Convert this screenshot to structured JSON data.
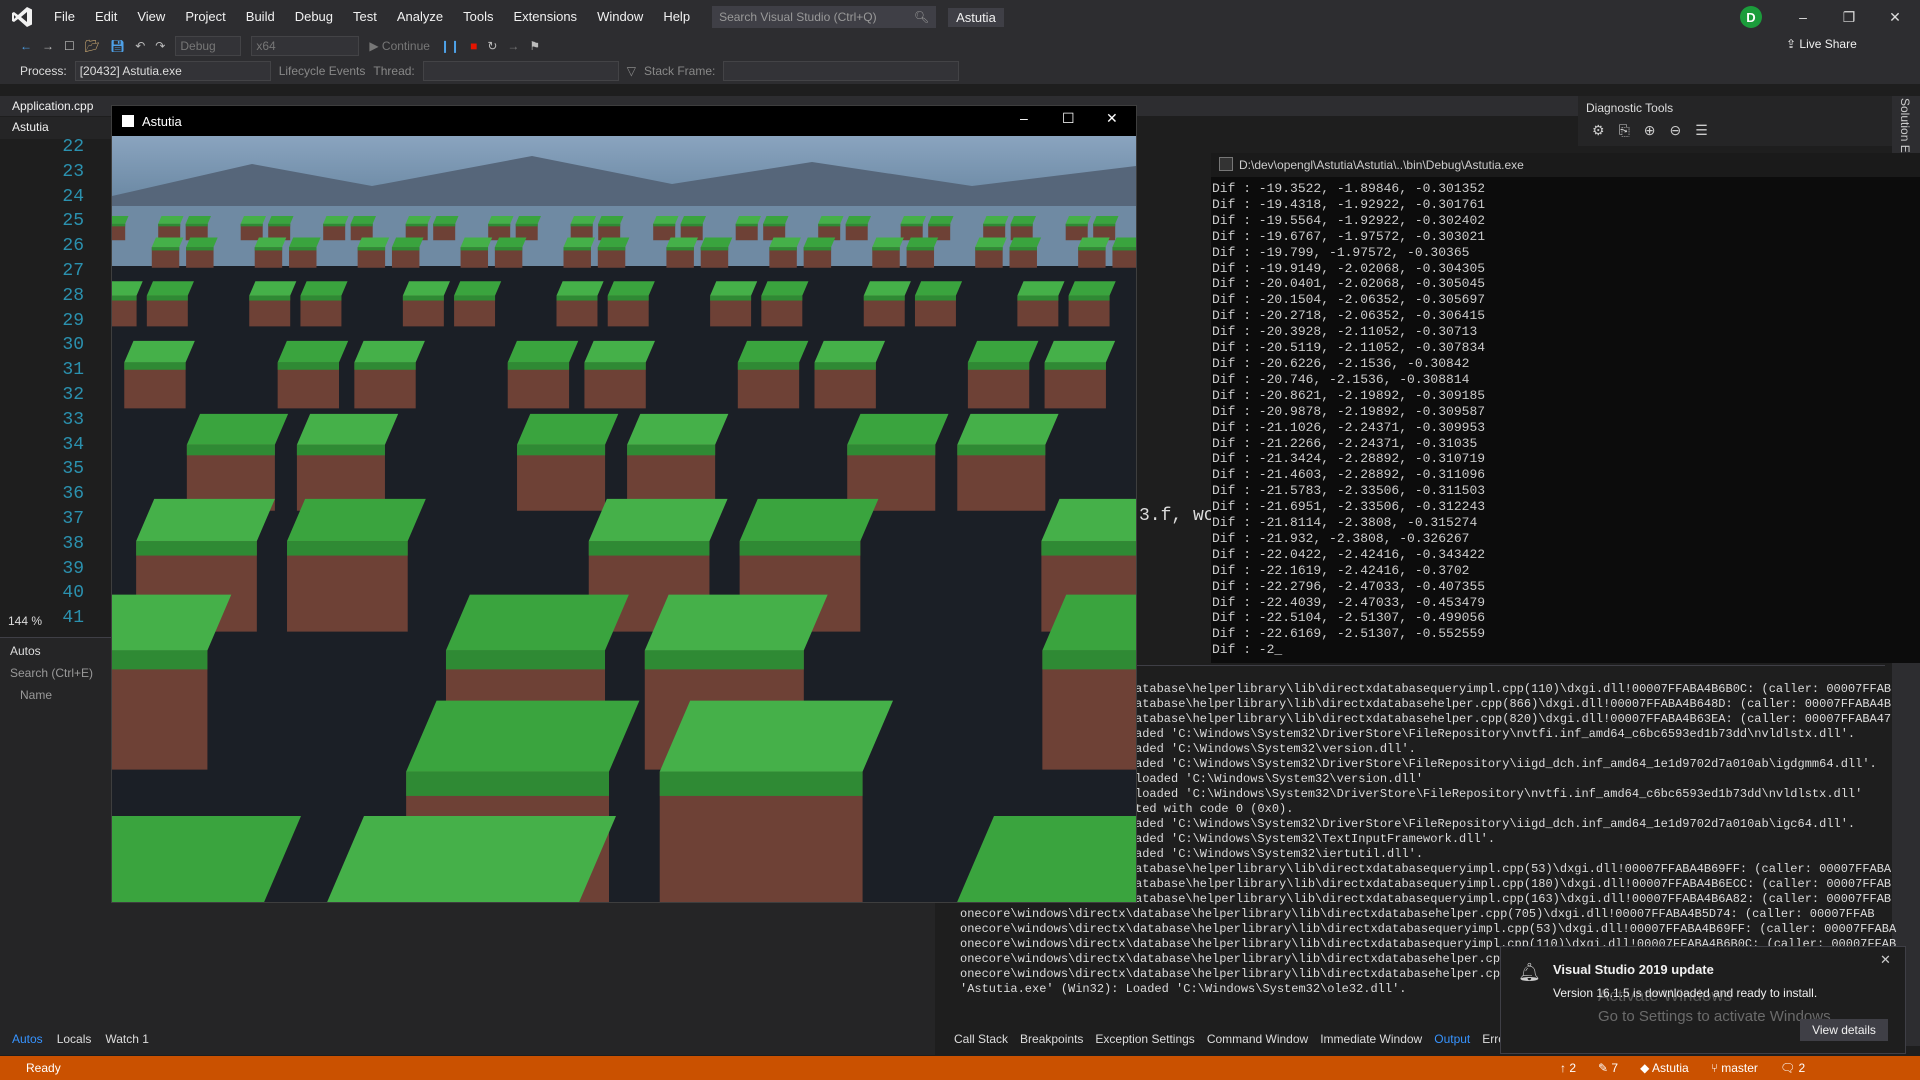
{
  "menu": [
    "File",
    "Edit",
    "View",
    "Project",
    "Build",
    "Debug",
    "Test",
    "Analyze",
    "Tools",
    "Extensions",
    "Window",
    "Help"
  ],
  "search": {
    "placeholder": "Search Visual Studio (Ctrl+Q)"
  },
  "solution_name": "Astutia",
  "avatar_letter": "D",
  "toolbar": {
    "config": "Debug",
    "platform": "x64",
    "continue": "Continue",
    "live_share": "Live Share"
  },
  "process_bar": {
    "process_label": "Process:",
    "process_value": "[20432] Astutia.exe",
    "lifecycle": "Lifecycle Events",
    "thread_label": "Thread:",
    "stack_frame_label": "Stack Frame:"
  },
  "editor": {
    "tab": "Application.cpp",
    "scope": "Astutia",
    "line_numbers": [
      "22",
      "23",
      "24",
      "25",
      "26",
      "27",
      "28",
      "29",
      "30",
      "31",
      "32",
      "33",
      "34",
      "35",
      "36",
      "37",
      "38",
      "39",
      "40",
      "41"
    ],
    "zoom": "144 %",
    "visible_code_fragment": "3.f, wo"
  },
  "autos": {
    "title": "Autos",
    "search_placeholder": "Search (Ctrl+E)",
    "col_name": "Name"
  },
  "bottom_tabs_left": [
    "Autos",
    "Locals",
    "Watch 1"
  ],
  "bottom_tabs_right": [
    "Call Stack",
    "Breakpoints",
    "Exception Settings",
    "Command Window",
    "Immediate Window",
    "Output",
    "Erro"
  ],
  "diagnostic": {
    "title": "Diagnostic Tools",
    "rail_text": "Solution E"
  },
  "console": {
    "title": "D:\\dev\\opengl\\Astutia\\Astutia\\..\\bin\\Debug\\Astutia.exe",
    "lines": [
      "Dif : -19.3522, -1.89846, -0.301352",
      "Dif : -19.4318, -1.92922, -0.301761",
      "Dif : -19.5564, -1.92922, -0.302402",
      "Dif : -19.6767, -1.97572, -0.303021",
      "Dif : -19.799, -1.97572, -0.30365",
      "Dif : -19.9149, -2.02068, -0.304305",
      "Dif : -20.0401, -2.02068, -0.305045",
      "Dif : -20.1504, -2.06352, -0.305697",
      "Dif : -20.2718, -2.06352, -0.306415",
      "Dif : -20.3928, -2.11052, -0.30713",
      "Dif : -20.5119, -2.11052, -0.307834",
      "Dif : -20.6226, -2.1536, -0.30842",
      "Dif : -20.746, -2.1536, -0.308814",
      "Dif : -20.8621, -2.19892, -0.309185",
      "Dif : -20.9878, -2.19892, -0.309587",
      "Dif : -21.1026, -2.24371, -0.309953",
      "Dif : -21.2266, -2.24371, -0.31035",
      "Dif : -21.3424, -2.28892, -0.310719",
      "Dif : -21.4603, -2.28892, -0.311096",
      "Dif : -21.5783, -2.33506, -0.311503",
      "Dif : -21.6951, -2.33506, -0.312243",
      "Dif : -21.8114, -2.3808, -0.315274",
      "Dif : -21.932, -2.3808, -0.326267",
      "Dif : -22.0422, -2.42416, -0.343422",
      "Dif : -22.1619, -2.42416, -0.3702",
      "Dif : -22.2796, -2.47033, -0.407355",
      "Dif : -22.4039, -2.47033, -0.453479",
      "Dif : -22.5104, -2.51307, -0.499056",
      "Dif : -22.6169, -2.51307, -0.552559",
      "Dif : -2_"
    ]
  },
  "output": {
    "lines": [
      "atabase\\helperlibrary\\lib\\directxdatabasequeryimpl.cpp(110)\\dxgi.dll!00007FFABA4B6B0C: (caller: 00007FFAB",
      "atabase\\helperlibrary\\lib\\directxdatabasehelper.cpp(866)\\dxgi.dll!00007FFABA4B648D: (caller: 00007FFABA4B",
      "atabase\\helperlibrary\\lib\\directxdatabasehelper.cpp(820)\\dxgi.dll!00007FFABA4B63EA: (caller: 00007FFABA47",
      "aded 'C:\\Windows\\System32\\DriverStore\\FileRepository\\nvtfi.inf_amd64_c6bc6593ed1b73dd\\nvldlstx.dll'.",
      "aded 'C:\\Windows\\System32\\version.dll'.",
      "aded 'C:\\Windows\\System32\\DriverStore\\FileRepository\\iigd_dch.inf_amd64_1e1d9702d7a010ab\\igdgmm64.dll'.",
      "loaded 'C:\\Windows\\System32\\version.dll'",
      "loaded 'C:\\Windows\\System32\\DriverStore\\FileRepository\\nvtfi.inf_amd64_c6bc6593ed1b73dd\\nvldlstx.dll'",
      "ted with code 0 (0x0).",
      "aded 'C:\\Windows\\System32\\DriverStore\\FileRepository\\iigd_dch.inf_amd64_1e1d9702d7a010ab\\igc64.dll'.",
      "aded 'C:\\Windows\\System32\\TextInputFramework.dll'.",
      "aded 'C:\\Windows\\System32\\iertutil.dll'.",
      "atabase\\helperlibrary\\lib\\directxdatabasequeryimpl.cpp(53)\\dxgi.dll!00007FFABA4B69FF: (caller: 00007FFABA",
      "atabase\\helperlibrary\\lib\\directxdatabasequeryimpl.cpp(180)\\dxgi.dll!00007FFABA4B6ECC: (caller: 00007FFAB",
      "atabase\\helperlibrary\\lib\\directxdatabasequeryimpl.cpp(163)\\dxgi.dll!00007FFABA4B6A82: (caller: 00007FFAB",
      "onecore\\windows\\directx\\database\\helperlibrary\\lib\\directxdatabasehelper.cpp(705)\\dxgi.dll!00007FFABA4B5D74: (caller: 00007FFAB",
      "onecore\\windows\\directx\\database\\helperlibrary\\lib\\directxdatabasequeryimpl.cpp(53)\\dxgi.dll!00007FFABA4B69FF: (caller: 00007FFABA",
      "onecore\\windows\\directx\\database\\helperlibrary\\lib\\directxdatabasequeryimpl.cpp(110)\\dxgi.dll!00007FFABA4B6B0C: (caller: 00007FFAB",
      "onecore\\windows\\directx\\database\\helperlibrary\\lib\\directxdatabasehelper.cpp(",
      "onecore\\windows\\directx\\database\\helperlibrary\\lib\\directxdatabasehelper.cpp(",
      "'Astutia.exe' (Win32): Loaded 'C:\\Windows\\System32\\ole32.dll'."
    ]
  },
  "game_window": {
    "title": "Astutia"
  },
  "notification": {
    "title": "Visual Studio 2019 update",
    "body": "Version 16.1.5 is downloaded and ready to install.",
    "button": "View details"
  },
  "watermark": {
    "line1": "Activate Windows",
    "line2": "Go to Settings to activate Windows."
  },
  "status": {
    "ready": "Ready",
    "up_count": "2",
    "pending_count": "7",
    "repo": "Astutia",
    "branch": "master",
    "notif_count": "2"
  },
  "colors": {
    "accent": "#007acc",
    "status_bar": "#ca5100",
    "grass": "#3aa43e",
    "dirt": "#6e4136"
  }
}
